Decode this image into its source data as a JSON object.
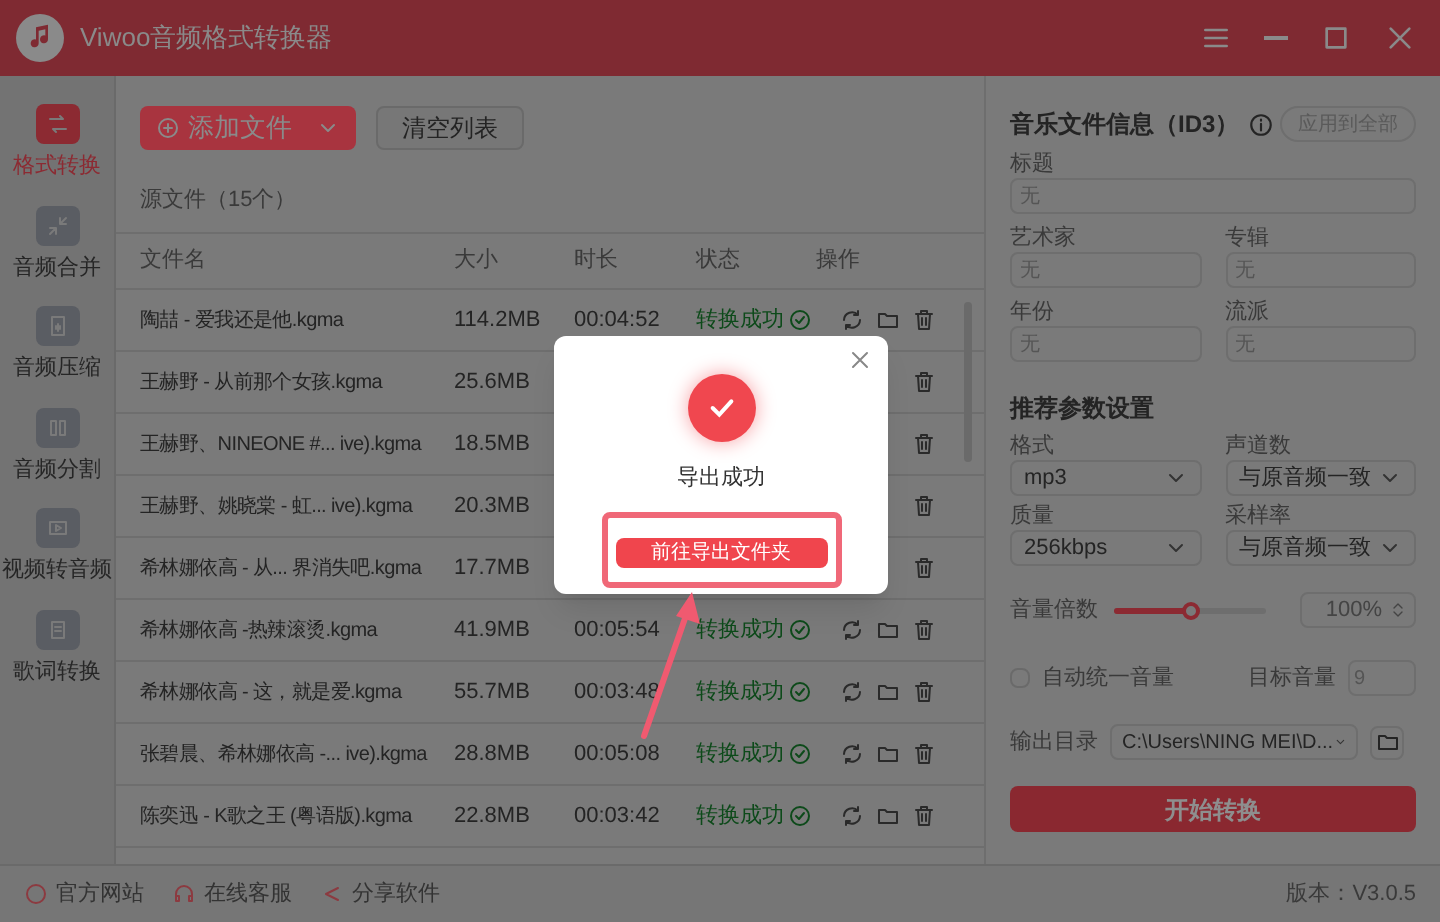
{
  "window": {
    "title": "Viwoo音频格式转换器"
  },
  "sidebar": {
    "items": [
      {
        "label": "格式转换",
        "selected": true
      },
      {
        "label": "音频合并",
        "selected": false
      },
      {
        "label": "音频压缩",
        "selected": false
      },
      {
        "label": "音频分割",
        "selected": false
      },
      {
        "label": "视频转音频",
        "selected": false
      },
      {
        "label": "歌词转换",
        "selected": false
      }
    ]
  },
  "toolbar": {
    "add": "添加文件",
    "clear": "清空列表"
  },
  "source_title": "源文件（15个）",
  "table": {
    "columns": [
      "文件名",
      "大小",
      "时长",
      "状态",
      "操作"
    ],
    "rows": [
      {
        "name": "陶喆 - 爱我还是他.kgma",
        "size": "114.2MB",
        "duration": "00:04:52",
        "status": "转换成功"
      },
      {
        "name": "王赫野 - 从前那个女孩.kgma",
        "size": "25.6MB"
      },
      {
        "name": "王赫野、NINEONE #... ive).kgma",
        "size": "18.5MB"
      },
      {
        "name": "王赫野、姚晓棠 - 虹... ive).kgma",
        "size": "20.3MB"
      },
      {
        "name": "希林娜依高 - 从... 界消失吧.kgma",
        "size": "17.7MB"
      },
      {
        "name": "希林娜依高 -热辣滚烫.kgma",
        "size": "41.9MB",
        "duration": "00:05:54",
        "status": "转换成功"
      },
      {
        "name": "希林娜依高 - 这，就是爱.kgma",
        "size": "55.7MB",
        "duration": "00:03:48",
        "status": "转换成功"
      },
      {
        "name": "张碧晨、希林娜依高 -... ive).kgma",
        "size": "28.8MB",
        "duration": "00:05:08",
        "status": "转换成功"
      },
      {
        "name": "陈奕迅 - K歌之王 (粤语版).kgma",
        "size": "22.8MB",
        "duration": "00:03:42",
        "status": "转换成功"
      }
    ]
  },
  "id3": {
    "title": "音乐文件信息（ID3）",
    "apply_all": "应用到全部",
    "fields": [
      {
        "label": "标题",
        "placeholder": "无",
        "wide": true
      },
      {
        "label": "艺术家",
        "placeholder": "无",
        "wide": false
      },
      {
        "label": "专辑",
        "placeholder": "无",
        "wide": false
      },
      {
        "label": "年份",
        "placeholder": "无",
        "wide": false
      },
      {
        "label": "流派",
        "placeholder": "无",
        "wide": false
      }
    ]
  },
  "params": {
    "title": "推荐参数设置",
    "selects": [
      {
        "label": "格式",
        "value": "mp3"
      },
      {
        "label": "声道数",
        "value": "与原音频一致"
      },
      {
        "label": "质量",
        "value": "256kbps"
      },
      {
        "label": "采样率",
        "value": "与原音频一致"
      }
    ],
    "volume": {
      "label": "音量倍数",
      "level": 0.5,
      "value": "100%"
    },
    "auto_volume": {
      "label": "自动统一音量",
      "checked": false,
      "target_label": "目标音量",
      "target_value": "9"
    },
    "output": {
      "label": "输出目录",
      "value": "C:\\Users\\NING MEI\\D..."
    },
    "start": "开始转换"
  },
  "footer": {
    "links": [
      "官方网站",
      "在线客服",
      "分享软件"
    ],
    "version": "版本：V3.0.5"
  },
  "dialog": {
    "message": "导出成功",
    "button": "前往导出文件夹"
  }
}
